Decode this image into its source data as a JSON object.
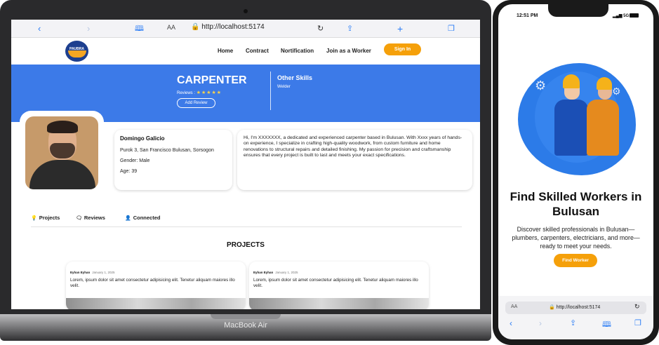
{
  "laptop": {
    "label": "MacBook Air",
    "browser": {
      "url": "http://localhost:5174",
      "text_size": "AA",
      "icons": [
        "back-icon",
        "forward-icon",
        "bookmarks-icon",
        "reload-icon",
        "share-icon",
        "new-tab-icon",
        "tabs-icon"
      ]
    },
    "site": {
      "logo_text": "PAUBRA",
      "nav": [
        "Home",
        "Contract",
        "Nortification",
        "Join as a Worker"
      ],
      "signin": "Sign In",
      "banner": {
        "title": "CARPENTER",
        "reviews_label": "Reviews :",
        "stars": "★★★★★",
        "add_review": "Add Review",
        "other_skills_title": "Other Skills",
        "other_skill": "Welder"
      },
      "profile": {
        "name": "Domingo Galicio",
        "address": "Purok 3, San Francisco Bulusan, Sorsogon",
        "gender": "Gender: Male",
        "age": "Age: 39",
        "bio": "Hi, I'm XXXXXXX, a dedicated and experienced carpenter based in Bulusan. With Xxxx years of hands-on experience, I specialize in crafting high-quality woodwork, from custom furniture and home renovations to structural repairs and detailed finishing. My passion for precision and craftsmanship ensures that every project is built to last and meets your exact specifications."
      },
      "tabs": [
        "Projects",
        "Reviews",
        "Connected"
      ],
      "projects_title": "PROJECTS",
      "projects": [
        {
          "author": "Eyhan Eyhan",
          "date": "January 1, 2025",
          "text": "Lorem, ipsum dolor sit amet consectetur adipisicing elit. Tenetur aliquam maiores illo velit."
        },
        {
          "author": "Eyhan Eyhan",
          "date": "January 1, 2025",
          "text": "Lorem, ipsum dolor sit amet consectetur adipisicing elit. Tenetur aliquam maiores illo velit."
        }
      ]
    }
  },
  "phone": {
    "time": "12:51 PM",
    "signal": "5G",
    "heading": "Find Skilled Workers in Bulusan",
    "description": "Discover skilled professionals in Bulusan—plumbers, carpenters, electricians, and more—ready to meet your needs.",
    "cta": "Find Worker",
    "browser": {
      "text_size": "AA",
      "url": "http://localhost:5174"
    }
  },
  "colors": {
    "banner_blue": "#3c7ae8",
    "accent_orange": "#f5a00a",
    "ios_blue": "#2a7cf5"
  }
}
